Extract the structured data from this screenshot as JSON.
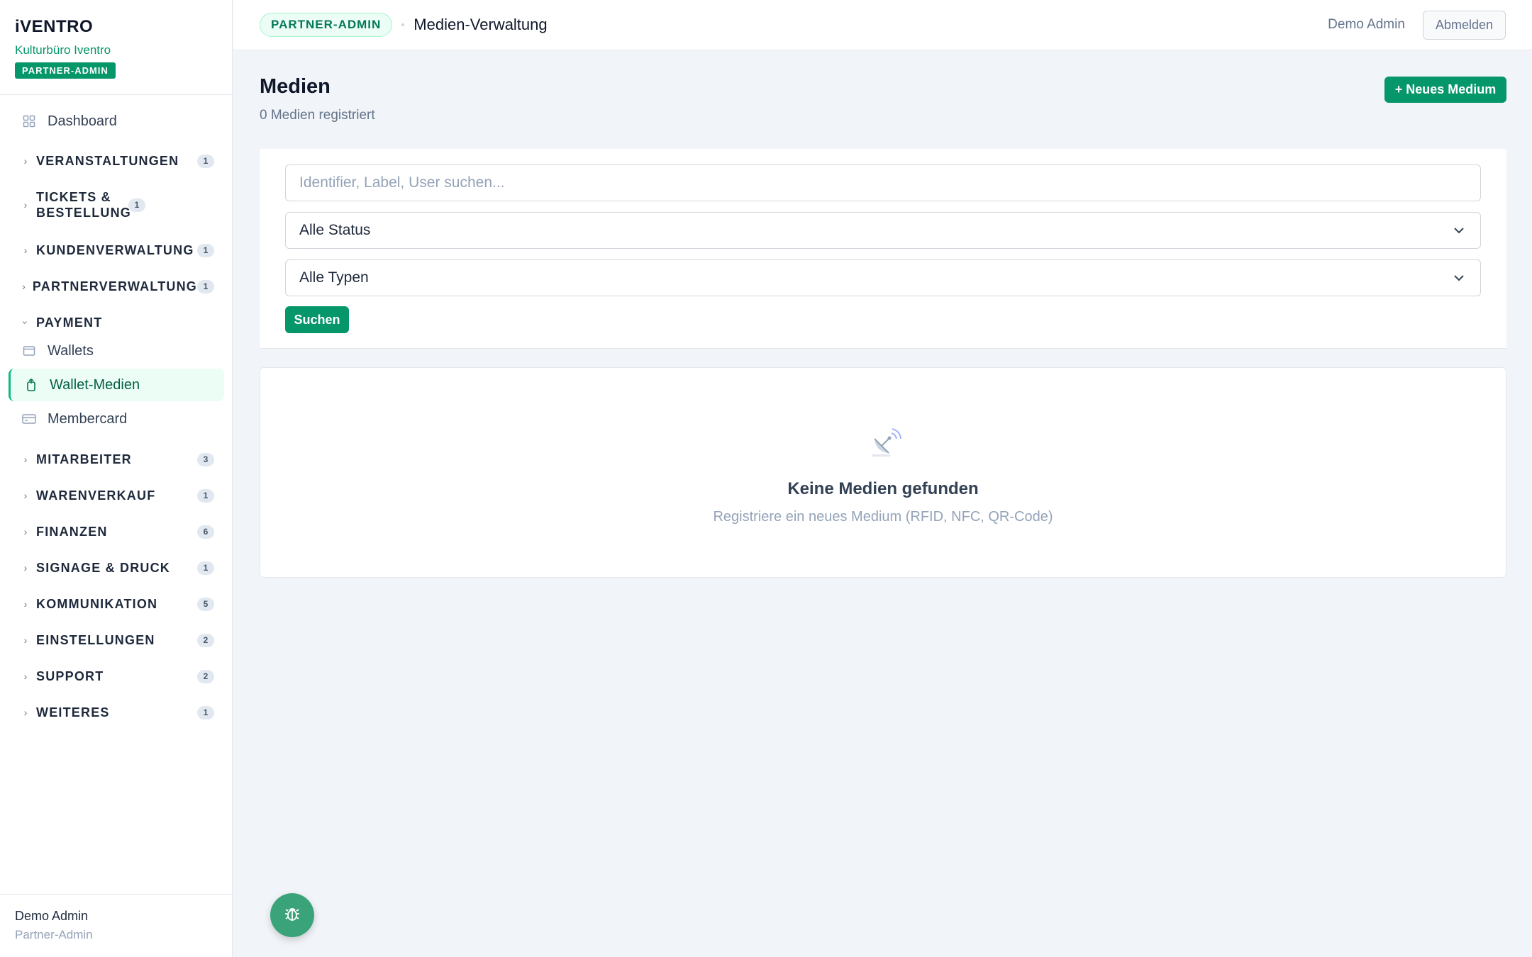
{
  "brand": {
    "logo": "iVENTRO",
    "org": "Kulturbüro Iventro",
    "role_badge": "PARTNER-ADMIN"
  },
  "sidebar": {
    "dashboard": {
      "label": "Dashboard",
      "icon": "grid-icon"
    },
    "groups": [
      {
        "label": "VERANSTALTUNGEN",
        "count": "1"
      },
      {
        "label": "TICKETS & BESTELLUNG",
        "count": "1"
      },
      {
        "label": "KUNDENVERWALTUNG",
        "count": "1"
      },
      {
        "label": "PARTNERVERWALTUNG",
        "count": "1"
      },
      {
        "label": "PAYMENT",
        "expanded": true
      },
      {
        "label": "MITARBEITER",
        "count": "3"
      },
      {
        "label": "WARENVERKAUF",
        "count": "1"
      },
      {
        "label": "FINANZEN",
        "count": "6"
      },
      {
        "label": "SIGNAGE & DRUCK",
        "count": "1"
      },
      {
        "label": "KOMMUNIKATION",
        "count": "5"
      },
      {
        "label": "EINSTELLUNGEN",
        "count": "2"
      },
      {
        "label": "SUPPORT",
        "count": "2"
      },
      {
        "label": "WEITERES",
        "count": "1"
      }
    ],
    "payment_items": [
      {
        "label": "Wallets",
        "icon": "wallet-icon"
      },
      {
        "label": "Wallet-Medien",
        "icon": "tap-card-icon",
        "active": true
      },
      {
        "label": "Membercard",
        "icon": "credit-card-icon"
      }
    ],
    "footer": {
      "name": "Demo Admin",
      "role": "Partner-Admin"
    }
  },
  "topbar": {
    "role_pill": "PARTNER-ADMIN",
    "breadcrumb": "Medien-Verwaltung",
    "user": "Demo Admin",
    "logout": "Abmelden"
  },
  "main": {
    "title": "Medien",
    "subtitle": "0 Medien registriert",
    "new_button": "+ Neues Medium",
    "search_placeholder": "Identifier, Label, User suchen...",
    "status_select": "Alle Status",
    "type_select": "Alle Typen",
    "search_button": "Suchen",
    "empty_title": "Keine Medien gefunden",
    "empty_sub": "Registriere ein neues Medium (RFID, NFC, QR-Code)"
  },
  "colors": {
    "accent": "#059669",
    "accent_light": "#ecfdf5",
    "background": "#f1f4f8"
  }
}
